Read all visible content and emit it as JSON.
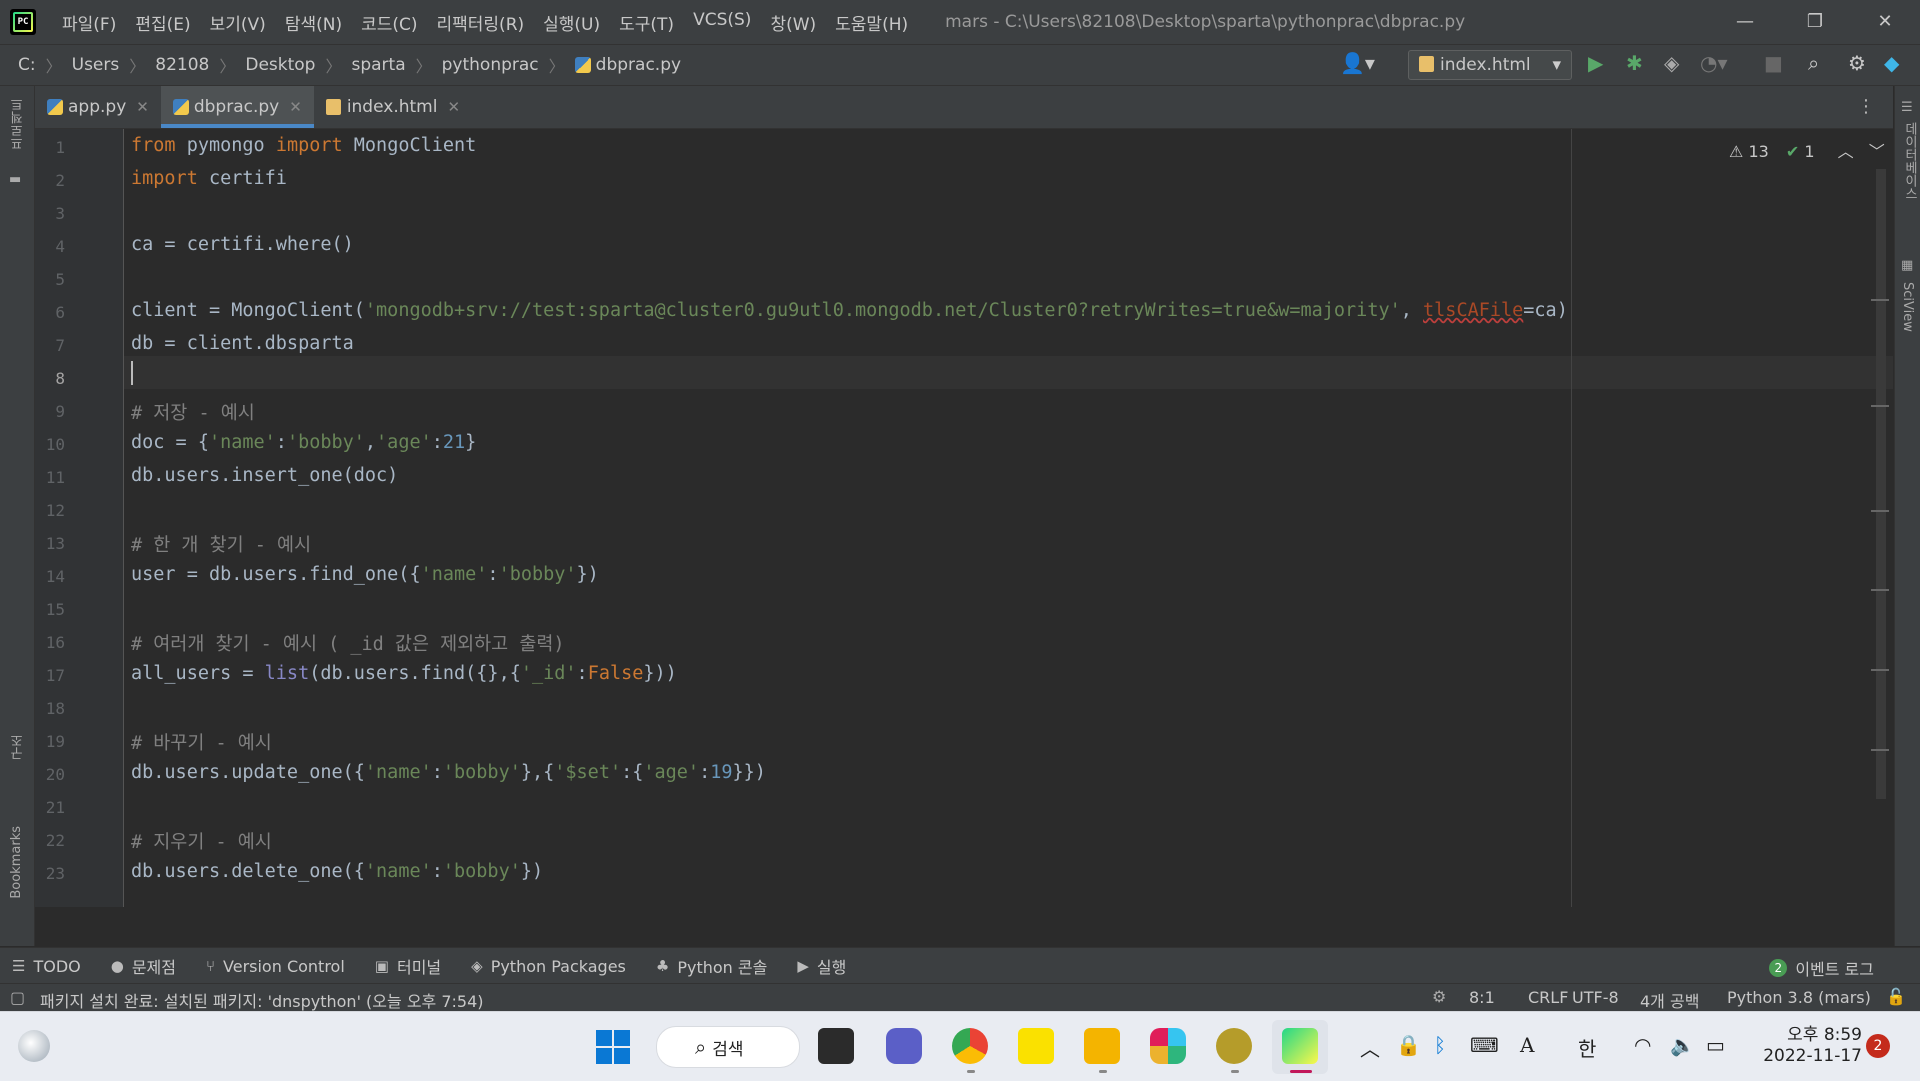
{
  "window": {
    "menu": [
      "파일(F)",
      "편집(E)",
      "보기(V)",
      "탐색(N)",
      "코드(C)",
      "리팩터링(R)",
      "실행(U)",
      "도구(T)",
      "VCS(S)",
      "창(W)",
      "도움말(H)"
    ],
    "title": "mars - C:\\Users\\82108\\Desktop\\sparta\\pythonprac\\dbprac.py"
  },
  "breadcrumb": {
    "drive": "C:",
    "parts": [
      "Users",
      "82108",
      "Desktop",
      "sparta",
      "pythonprac"
    ],
    "file": "dbprac.py"
  },
  "run_config": "index.html",
  "tabs": [
    {
      "label": "app.py",
      "active": false
    },
    {
      "label": "dbprac.py",
      "active": true
    },
    {
      "label": "index.html",
      "active": false
    }
  ],
  "left_strip": {
    "project": "프로젝트",
    "structure": "구조",
    "bookmarks": "Bookmarks"
  },
  "right_strip": {
    "database": "데이터베이스",
    "sciview": "SciView"
  },
  "inspections": {
    "warnings": "13",
    "ok": "1"
  },
  "editor": {
    "current_line": 8,
    "lines": [
      "from pymongo import MongoClient",
      "import certifi",
      "",
      "ca = certifi.where()",
      "",
      "client = MongoClient('mongodb+srv://test:sparta@cluster0.gu9utl0.mongodb.net/Cluster0?retryWrites=true&w=majority', tlsCAFile=ca)",
      "db = client.dbsparta",
      "",
      "# 저장 - 예시",
      "doc = {'name':'bobby','age':21}",
      "db.users.insert_one(doc)",
      "",
      "# 한 개 찾기 - 예시",
      "user = db.users.find_one({'name':'bobby'})",
      "",
      "# 여러개 찾기 - 예시 ( _id 값은 제외하고 출력)",
      "all_users = list(db.users.find({},{'_id':False}))",
      "",
      "# 바꾸기 - 예시",
      "db.users.update_one({'name':'bobby'},{'$set':{'age':19}})",
      "",
      "# 지우기 - 예시",
      "db.users.delete_one({'name':'bobby'})"
    ]
  },
  "tool_windows": [
    "TODO",
    "문제점",
    "Version Control",
    "터미널",
    "Python Packages",
    "Python 콘솔",
    "실행"
  ],
  "event_log": {
    "count": "2",
    "label": "이벤트 로그"
  },
  "status": {
    "message": "패키지 설치 완료: 설치된 패키지: 'dnspython' (오늘 오후 7:54)",
    "position": "8:1",
    "line_sep": "CRLF",
    "encoding": "UTF-8",
    "indent": "4개 공백",
    "interpreter": "Python 3.8 (mars)"
  },
  "taskbar": {
    "search": "검색",
    "clock_time": "오후 8:59",
    "clock_date": "2022-11-17",
    "ime": "한",
    "notifications": "2"
  }
}
